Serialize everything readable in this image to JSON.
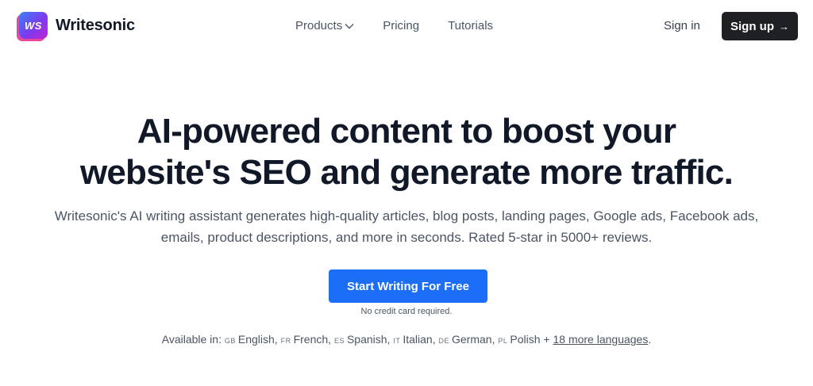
{
  "brand": {
    "badge": "WS",
    "name": "Writesonic"
  },
  "nav": {
    "products": "Products",
    "pricing": "Pricing",
    "tutorials": "Tutorials"
  },
  "auth": {
    "sign_in": "Sign in",
    "sign_up": "Sign up",
    "sign_up_arrow": "→"
  },
  "hero": {
    "title_line1": "AI-powered content to boost your",
    "title_line2": "website's SEO and generate more traffic.",
    "subtitle_line1": "Writesonic's AI writing assistant generates high-quality articles, blog posts, landing pages, Google ads, Facebook ads,",
    "subtitle_line2": "emails, product descriptions, and more in seconds. Rated 5-star in 5000+ reviews.",
    "cta": "Start Writing For Free",
    "cta_note": "No credit card required."
  },
  "languages": {
    "prefix": "Available in:",
    "items": [
      {
        "code": "GB",
        "name": "English,"
      },
      {
        "code": "FR",
        "name": "French,"
      },
      {
        "code": "ES",
        "name": "Spanish,"
      },
      {
        "code": "IT",
        "name": "Italian,"
      },
      {
        "code": "DE",
        "name": "German,"
      },
      {
        "code": "PL",
        "name": "Polish"
      }
    ],
    "plus": "+",
    "more": "18 more languages",
    "suffix": "."
  },
  "colors": {
    "accent": "#1b6ef5",
    "dark_button": "#1f2023"
  }
}
